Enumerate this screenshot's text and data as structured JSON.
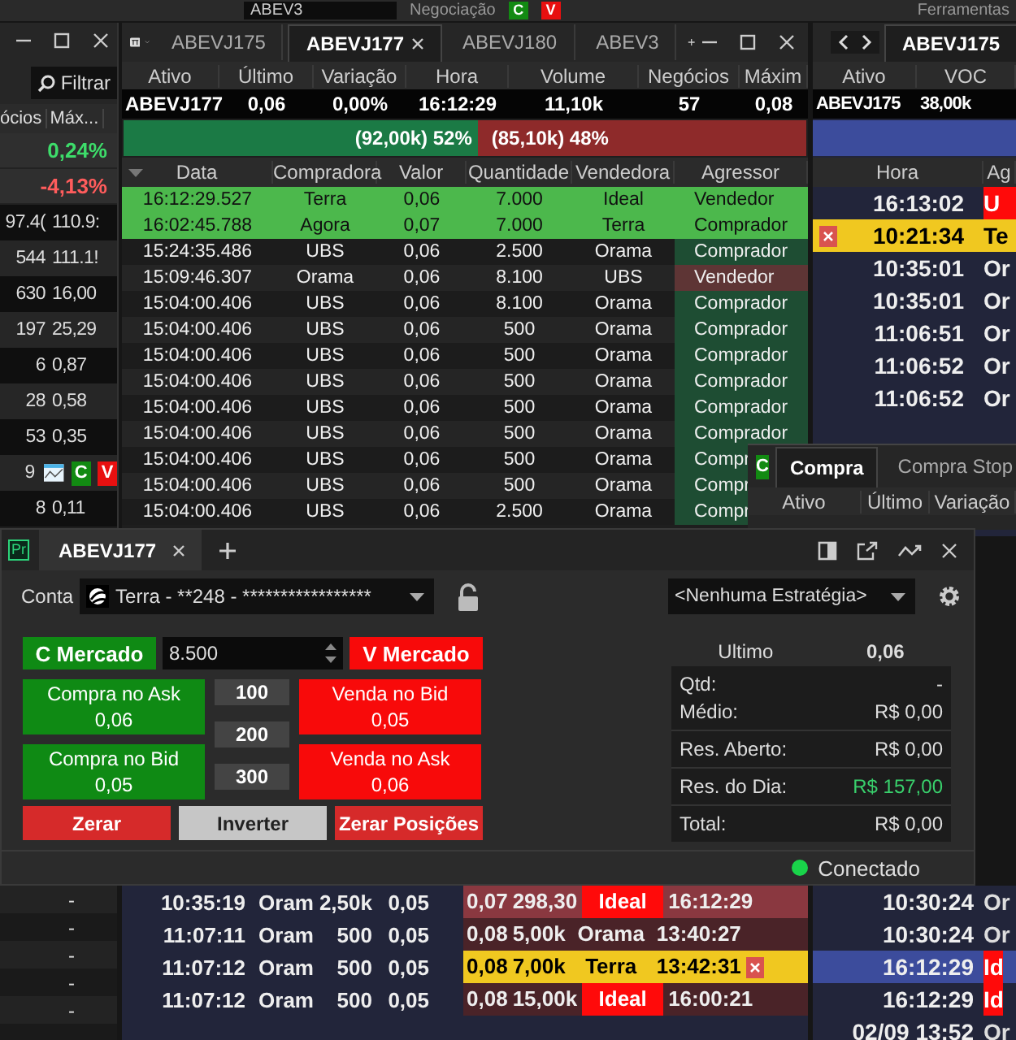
{
  "toolbar": {
    "symbol": "ABEV3",
    "menu_1": "Negociação",
    "menu_2": "Ferramentas",
    "buttons": [
      "C",
      "V"
    ]
  },
  "left_panel": {
    "filter_button": "Filtrar",
    "columns": [
      "ócios",
      "Máx..."
    ],
    "change_rows": [
      {
        "value": "0,24%",
        "positive": true
      },
      {
        "value": "-4,13%",
        "positive": false
      }
    ],
    "rows": [
      {
        "kind": "values",
        "cells": [
          "97.4(",
          "110.9:"
        ]
      },
      {
        "kind": "values",
        "cells": [
          "544",
          "111.1!"
        ]
      },
      {
        "kind": "values",
        "cells": [
          "630",
          "16,00"
        ]
      },
      {
        "kind": "values",
        "cells": [
          "197",
          "25,29"
        ]
      },
      {
        "kind": "values",
        "cells": [
          "6",
          "0,87"
        ]
      },
      {
        "kind": "values",
        "cells": [
          "28",
          "0,58"
        ]
      },
      {
        "kind": "values",
        "cells": [
          "53",
          "0,35"
        ]
      },
      {
        "kind": "actions",
        "cells": [
          "9"
        ],
        "buttons": [
          "C",
          "V"
        ]
      },
      {
        "kind": "values",
        "cells": [
          "8",
          "0,11"
        ]
      }
    ],
    "bottom_rows": [
      "-",
      "-",
      "-",
      "-",
      "-"
    ]
  },
  "trades_window": {
    "tabs": [
      {
        "label": "ABEVJ175",
        "selected": false
      },
      {
        "label": "ABEVJ177",
        "selected": true
      },
      {
        "label": "ABEVJ180",
        "selected": false
      },
      {
        "label": "ABEV3",
        "selected": false
      }
    ],
    "quote_columns": [
      "Ativo",
      "Último",
      "Variação",
      "Hora",
      "Volume",
      "Negócios",
      "Máxim"
    ],
    "quote_values": [
      "ABEVJ177",
      "0,06",
      "0,00%",
      "16:12:29",
      "11,10k",
      "57",
      "0,08"
    ],
    "balance": {
      "buy_label": "(92,00k) 52%",
      "sell_label": "(85,10k) 48%",
      "level": 0.52
    },
    "columns": [
      "Data",
      "Compradora",
      "Valor",
      "Quantidade",
      "Vendedora",
      "Agressor"
    ],
    "rows": [
      {
        "cells": [
          "16:12:29.527",
          "Terra",
          "0,06",
          "7.000",
          "Ideal",
          "Vendedor"
        ],
        "highlight": true
      },
      {
        "cells": [
          "16:02:45.788",
          "Agora",
          "0,07",
          "7.000",
          "Terra",
          "Comprador"
        ],
        "highlight": true
      },
      {
        "cells": [
          "15:24:35.486",
          "UBS",
          "0,06",
          "2.500",
          "Orama",
          "Comprador"
        ],
        "highlight": false,
        "buyer_aggressor": true
      },
      {
        "cells": [
          "15:09:46.307",
          "Orama",
          "0,06",
          "8.100",
          "UBS",
          "Vendedor"
        ],
        "highlight": false,
        "buyer_aggressor": false
      },
      {
        "cells": [
          "15:04:00.406",
          "UBS",
          "0,06",
          "8.100",
          "Orama",
          "Comprador"
        ],
        "highlight": false,
        "buyer_aggressor": true
      },
      {
        "cells": [
          "15:04:00.406",
          "UBS",
          "0,06",
          "500",
          "Orama",
          "Comprador"
        ],
        "highlight": false,
        "buyer_aggressor": true
      },
      {
        "cells": [
          "15:04:00.406",
          "UBS",
          "0,06",
          "500",
          "Orama",
          "Comprador"
        ],
        "highlight": false,
        "buyer_aggressor": true
      },
      {
        "cells": [
          "15:04:00.406",
          "UBS",
          "0,06",
          "500",
          "Orama",
          "Comprador"
        ],
        "highlight": false,
        "buyer_aggressor": true
      },
      {
        "cells": [
          "15:04:00.406",
          "UBS",
          "0,06",
          "500",
          "Orama",
          "Comprador"
        ],
        "highlight": false,
        "buyer_aggressor": true
      },
      {
        "cells": [
          "15:04:00.406",
          "UBS",
          "0,06",
          "500",
          "Orama",
          "Comprador"
        ],
        "highlight": false,
        "buyer_aggressor": true
      },
      {
        "cells": [
          "15:04:00.406",
          "UBS",
          "0,06",
          "500",
          "Orama",
          "Compr"
        ],
        "highlight": false,
        "buyer_aggressor": true
      },
      {
        "cells": [
          "15:04:00.406",
          "UBS",
          "0,06",
          "500",
          "Orama",
          "Compr"
        ],
        "highlight": false,
        "buyer_aggressor": true
      },
      {
        "cells": [
          "15:04:00.406",
          "UBS",
          "0,06",
          "2.500",
          "Orama",
          "Compr"
        ],
        "highlight": false,
        "buyer_aggressor": true
      }
    ]
  },
  "orders_window": {
    "tab": "ABEVJ175",
    "quote_columns": [
      "Ativo",
      "VOC"
    ],
    "quote_values": [
      "ABEVJ175",
      "38,00k"
    ],
    "columns": [
      "Hora",
      "Ag"
    ],
    "rows": [
      {
        "time": "16:13:02",
        "agent": "U",
        "kind": "flagged"
      },
      {
        "time": "10:21:34",
        "agent": "Te",
        "kind": "own"
      },
      {
        "time": "10:35:01",
        "agent": "Or",
        "kind": "plain"
      },
      {
        "time": "10:35:01",
        "agent": "Or",
        "kind": "plain"
      },
      {
        "time": "11:06:51",
        "agent": "Or",
        "kind": "plain"
      },
      {
        "time": "11:06:52",
        "agent": "Or",
        "kind": "plain"
      },
      {
        "time": "11:06:52",
        "agent": "Or",
        "kind": "plain"
      }
    ],
    "lower_rows": [
      {
        "time": "10:30:24",
        "agent": "Or",
        "selected": false,
        "flagged": false
      },
      {
        "time": "10:30:24",
        "agent": "Or",
        "selected": false,
        "flagged": false
      },
      {
        "time": "16:12:29",
        "agent": "Id",
        "selected": true,
        "flagged": true
      },
      {
        "time": "16:12:29",
        "agent": "Id",
        "selected": false,
        "flagged": true
      },
      {
        "time": "02/09 13:52",
        "agent": "Or",
        "selected": false,
        "flagged": false
      }
    ]
  },
  "ticket_window": {
    "button": "C",
    "tabs": [
      {
        "label": "Compra",
        "selected": true
      },
      {
        "label": "Compra Stop",
        "selected": false
      }
    ],
    "columns": [
      "Ativo",
      "Último",
      "Variação"
    ]
  },
  "order_window": {
    "icon_label": "Pr",
    "tab": "ABEVJ177",
    "account_label": "Conta",
    "account": "Terra - **248 - *****************",
    "strategy": "<Nenhuma Estratégia>",
    "market_buy": "C Mercado",
    "quantity": "8.500",
    "market_sell": "V Mercado",
    "buy_buttons": [
      {
        "label": "Compra no Ask",
        "price": "0,06"
      },
      {
        "label": "Compra no Bid",
        "price": "0,05"
      }
    ],
    "quantity_presets": [
      "100",
      "200",
      "300"
    ],
    "sell_buttons": [
      {
        "label": "Venda no Bid",
        "price": "0,05"
      },
      {
        "label": "Venda no Ask",
        "price": "0,06"
      }
    ],
    "actions": [
      {
        "label": "Zerar",
        "kind": "danger"
      },
      {
        "label": "Inverter",
        "kind": "neutral"
      },
      {
        "label": "Zerar Posições",
        "kind": "danger"
      }
    ],
    "last_label": "Ultimo",
    "last_value": "0,06",
    "position_sections": [
      {
        "items": [
          {
            "label": "Qtd:",
            "value": "-",
            "positive": false
          },
          {
            "label": "Médio:",
            "value": "R$ 0,00",
            "positive": false
          }
        ]
      },
      {
        "items": [
          {
            "label": "Res. Aberto:",
            "value": "R$ 0,00",
            "positive": false
          }
        ]
      },
      {
        "items": [
          {
            "label": "Res. do Dia:",
            "value": "R$ 157,00",
            "positive": true
          }
        ]
      },
      {
        "items": [
          {
            "label": "Total:",
            "value": "R$ 0,00",
            "positive": false
          }
        ]
      }
    ],
    "status": {
      "label": "Conectado",
      "connected": true
    }
  },
  "book": {
    "rows": [
      {
        "time": "10:35:19",
        "broker": "Oram",
        "qty": "2,50k",
        "bid": "0,05",
        "ask": "0,07",
        "ask_qty": "298,30",
        "ask_broker": "Ideal",
        "ask_time": "16:12:29",
        "broker_flag": true,
        "own": false
      },
      {
        "time": "11:07:11",
        "broker": "Oram",
        "qty": "500",
        "bid": "0,05",
        "ask": "0,08",
        "ask_qty": "5,00k",
        "ask_broker": "Orama",
        "ask_time": "13:40:27",
        "broker_flag": false,
        "own": false
      },
      {
        "time": "11:07:12",
        "broker": "Oram",
        "qty": "500",
        "bid": "0,05",
        "ask": "0,08",
        "ask_qty": "7,00k",
        "ask_broker": "Terra",
        "ask_time": "13:42:31",
        "broker_flag": false,
        "own": true
      },
      {
        "time": "11:07:12",
        "broker": "Oram",
        "qty": "500",
        "bid": "0,05",
        "ask": "0,08",
        "ask_qty": "15,00k",
        "ask_broker": "Ideal",
        "ask_time": "16:00:21",
        "broker_flag": true,
        "own": false
      }
    ]
  }
}
